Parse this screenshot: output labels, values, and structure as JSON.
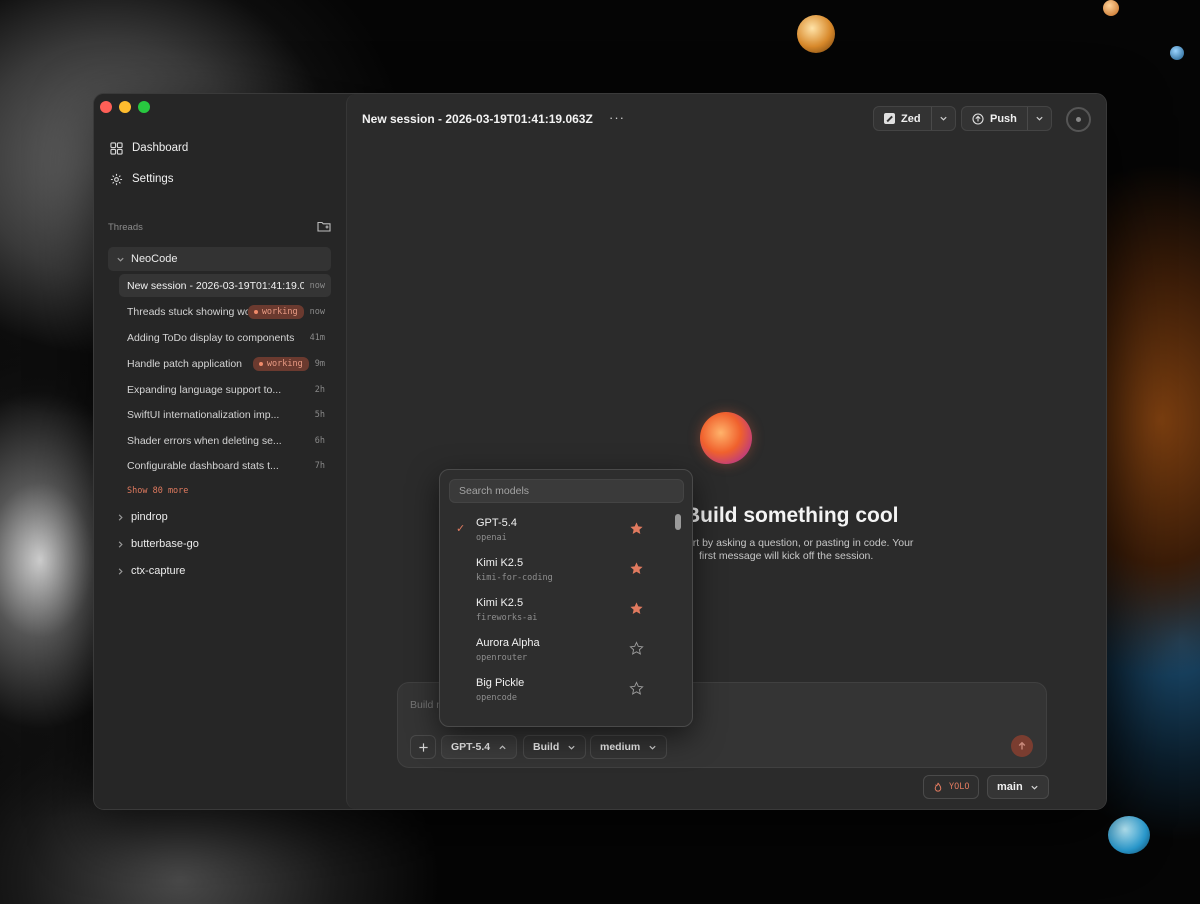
{
  "sidebar": {
    "nav": {
      "dashboard": "Dashboard",
      "settings": "Settings"
    },
    "threads_label": "Threads",
    "projects": [
      {
        "name": "NeoCode",
        "threads": [
          {
            "title": "New session - 2026-03-19T01:41:19.063Z",
            "time": "now",
            "badge": ""
          },
          {
            "title": "Threads stuck showing working",
            "time": "now",
            "badge": "working"
          },
          {
            "title": "Adding ToDo display to components",
            "time": "41m",
            "badge": ""
          },
          {
            "title": "Handle patch application",
            "time": "9m",
            "badge": "working"
          },
          {
            "title": "Expanding language support to...",
            "time": "2h",
            "badge": ""
          },
          {
            "title": "SwiftUI internationalization imp...",
            "time": "5h",
            "badge": ""
          },
          {
            "title": "Shader errors when deleting se...",
            "time": "6h",
            "badge": ""
          },
          {
            "title": "Configurable dashboard stats t...",
            "time": "7h",
            "badge": ""
          }
        ],
        "show_more": "Show 80 more"
      },
      {
        "name": "pindrop"
      },
      {
        "name": "butterbase-go"
      },
      {
        "name": "ctx-capture"
      }
    ]
  },
  "header": {
    "session_title": "New session - 2026-03-19T01:41:19.063Z",
    "more": "···",
    "editor_button": "Zed",
    "push_button": "Push"
  },
  "hero": {
    "title": "Build something cool",
    "subtitle_line1": "Start by asking a question, or pasting in code. Your",
    "subtitle_line2": "first message will kick off the session."
  },
  "composer": {
    "placeholder": "Build mode",
    "model": "GPT-5.4",
    "mode": "Build",
    "effort": "medium"
  },
  "footer": {
    "yolo": "YOLO",
    "branch": "main"
  },
  "model_picker": {
    "search_placeholder": "Search models",
    "items": [
      {
        "name": "GPT-5.4",
        "provider": "openai",
        "selected": true,
        "starred": true
      },
      {
        "name": "Kimi K2.5",
        "provider": "kimi-for-coding",
        "selected": false,
        "starred": true
      },
      {
        "name": "Kimi K2.5",
        "provider": "fireworks-ai",
        "selected": false,
        "starred": true
      },
      {
        "name": "Aurora Alpha",
        "provider": "openrouter",
        "selected": false,
        "starred": false
      },
      {
        "name": "Big Pickle",
        "provider": "opencode",
        "selected": false,
        "starred": false
      }
    ]
  },
  "colors": {
    "accent": "#e07a5f",
    "badge_bg": "#6b3a2f",
    "window_bg": "#262626",
    "panel_bg": "#2b2b2b"
  }
}
